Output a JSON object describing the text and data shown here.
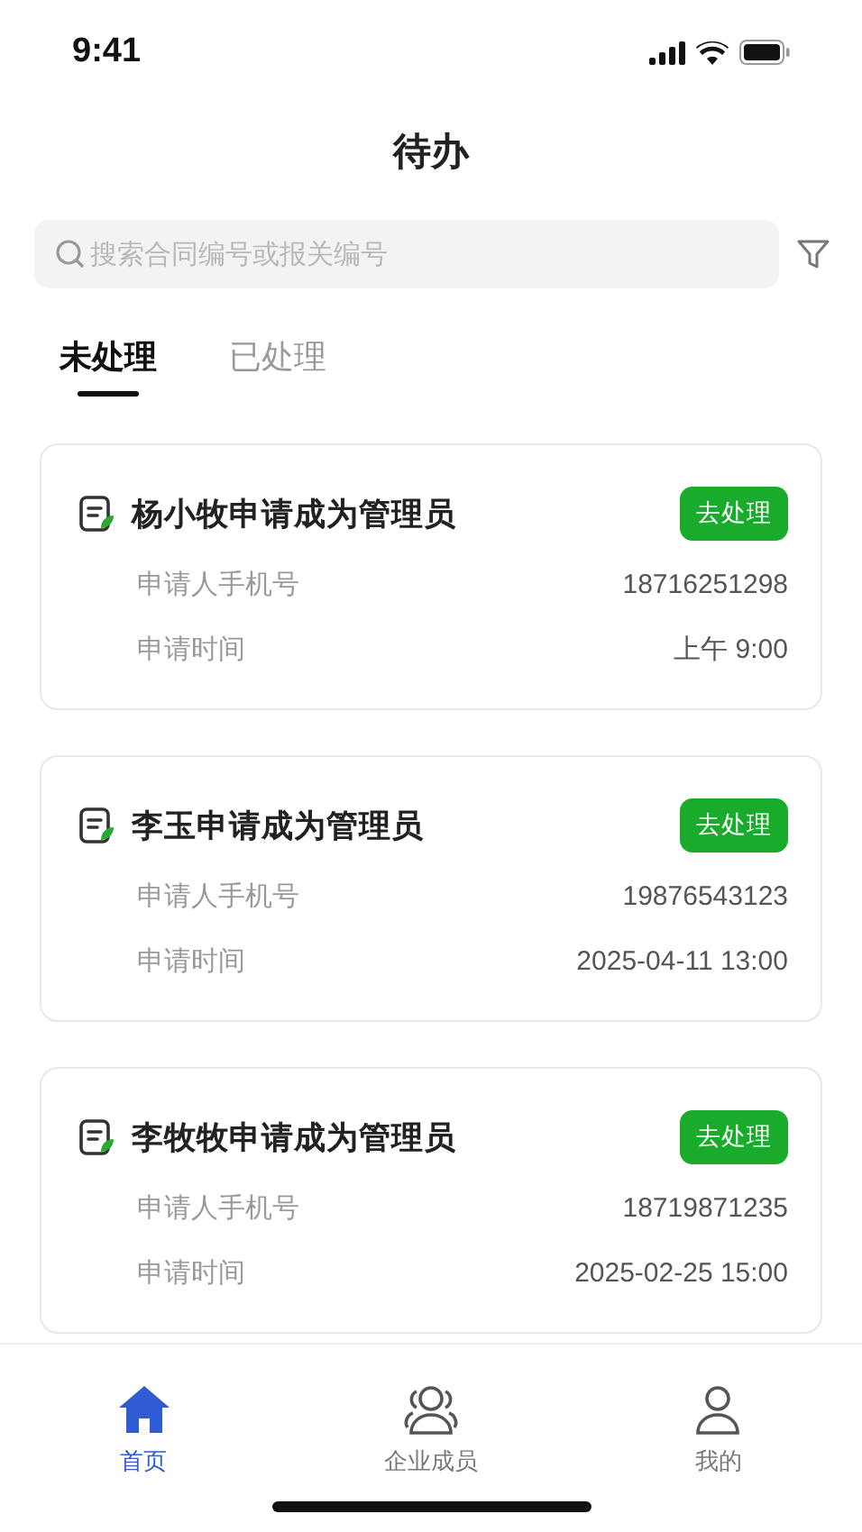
{
  "status_bar": {
    "time": "9:41"
  },
  "title": "待办",
  "search": {
    "placeholder": "搜索合同编号或报关编号"
  },
  "tabs": [
    {
      "label": "未处理",
      "selected": true
    },
    {
      "label": "已处理",
      "selected": false
    }
  ],
  "cards": [
    {
      "title": "杨小牧申请成为管理员",
      "action": "去处理",
      "fields": [
        {
          "label": "申请人手机号",
          "value": "18716251298"
        },
        {
          "label": "申请时间",
          "value": "上午 9:00"
        }
      ]
    },
    {
      "title": "李玉申请成为管理员",
      "action": "去处理",
      "fields": [
        {
          "label": "申请人手机号",
          "value": "19876543123"
        },
        {
          "label": "申请时间",
          "value": "2025-04-11 13:00"
        }
      ]
    },
    {
      "title": "李牧牧申请成为管理员",
      "action": "去处理",
      "fields": [
        {
          "label": "申请人手机号",
          "value": "18719871235"
        },
        {
          "label": "申请时间",
          "value": "2025-02-25 15:00"
        }
      ]
    }
  ],
  "nav": [
    {
      "kind": "home",
      "label": "首页",
      "selected": true
    },
    {
      "kind": "members",
      "label": "企业成员",
      "selected": false
    },
    {
      "kind": "profile",
      "label": "我的",
      "selected": false
    }
  ]
}
